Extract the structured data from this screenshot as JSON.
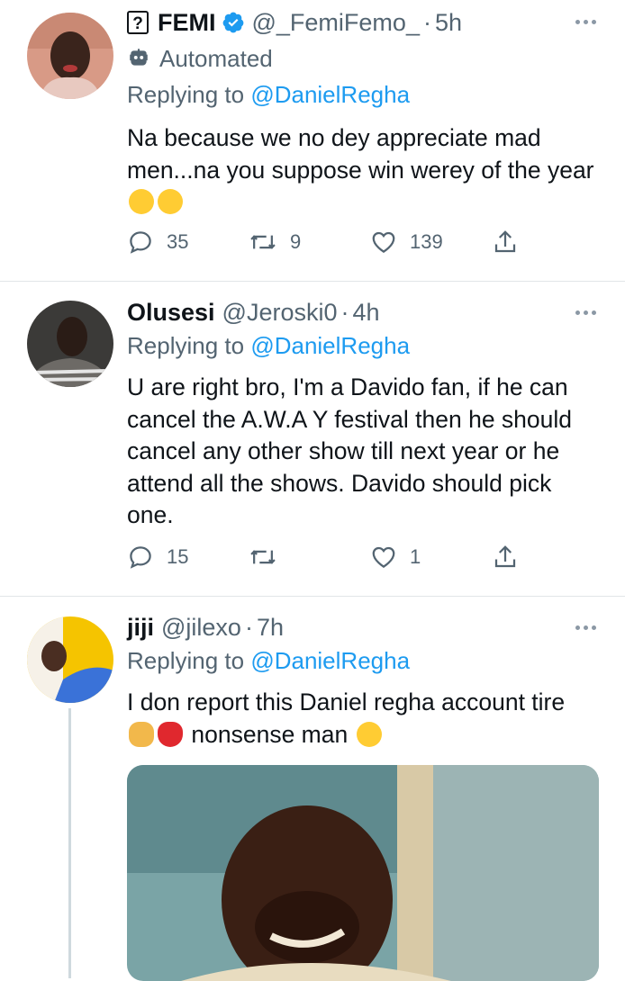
{
  "tweets": [
    {
      "name": "FEMI",
      "name_prefix_icon": "question-box-icon",
      "verified": true,
      "handle": "@_FemiFemo_",
      "dot": "·",
      "time": "5h",
      "automated_label": "Automated",
      "replying_prefix": "Replying to",
      "replying_mention": "@DanielRegha",
      "text": "Na because we no dey appreciate mad men...na you suppose win werey of the year",
      "emojis": [
        "loudly-crying-face",
        "loudly-crying-face"
      ],
      "counts": {
        "replies": "35",
        "retweets": "9",
        "likes": "139"
      }
    },
    {
      "name": "Olusesi",
      "handle": "@Jeroski0",
      "dot": "·",
      "time": "4h",
      "replying_prefix": "Replying to",
      "replying_mention": "@DanielRegha",
      "text": "U are right bro, I'm a Davido fan, if he can cancel the A.W.A Y festival then he should cancel any other show till next year or he attend all the shows. Davido should pick one.",
      "counts": {
        "replies": "15",
        "retweets": "",
        "likes": "1"
      }
    },
    {
      "name": "jiji",
      "handle": "@jilexo",
      "dot": "·",
      "time": "7h",
      "replying_prefix": "Replying to",
      "replying_mention": "@DanielRegha",
      "text_part1": "I don report this Daniel regha account tire",
      "text_part2": "nonsense man",
      "emojis": [
        "face-palm",
        "broken-heart",
        "smirking-face"
      ],
      "media": "photo-crying-child"
    }
  ],
  "colors": {
    "text": "#0f1419",
    "secondary": "#536471",
    "link": "#1d9bf0",
    "verified": "#1d9bf0",
    "divider": "#e1e5e8"
  }
}
